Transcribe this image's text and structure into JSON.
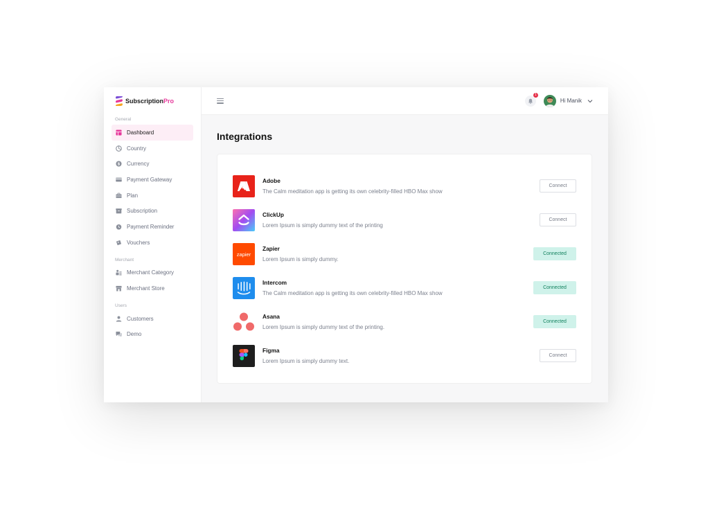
{
  "brand": {
    "name": "Subscription",
    "suffix": "Pro"
  },
  "sidebar": {
    "sections": [
      {
        "label": "General"
      },
      {
        "label": "Merchant"
      },
      {
        "label": "Users"
      }
    ],
    "general_items": [
      {
        "label": "Dashboard",
        "icon": "dashboard-icon",
        "active": true
      },
      {
        "label": "Country",
        "icon": "globe-icon"
      },
      {
        "label": "Currency",
        "icon": "dollar-icon"
      },
      {
        "label": "Payment Gateway",
        "icon": "card-icon"
      },
      {
        "label": "Plan",
        "icon": "briefcase-icon"
      },
      {
        "label": "Subscription",
        "icon": "box-icon"
      },
      {
        "label": "Payment Reminder",
        "icon": "clock-icon"
      },
      {
        "label": "Vouchers",
        "icon": "ticket-icon"
      }
    ],
    "merchant_items": [
      {
        "label": "Merchant Category",
        "icon": "category-icon"
      },
      {
        "label": "Merchant Store",
        "icon": "store-icon"
      }
    ],
    "user_items": [
      {
        "label": "Customers",
        "icon": "user-icon"
      },
      {
        "label": "Demo",
        "icon": "chat-icon"
      }
    ]
  },
  "header": {
    "notification_count": "1",
    "user_greeting": "Hi Manik"
  },
  "page": {
    "title": "Integrations"
  },
  "integrations": [
    {
      "name": "Adobe",
      "description": "The Calm meditation app is getting its own celebrity-filled HBO Max show",
      "button": "Connect",
      "connected": false,
      "brand_color": "#e8231a"
    },
    {
      "name": "ClickUp",
      "description": "Lorem Ipsum is simply dummy text of the printing",
      "button": "Connect",
      "connected": false,
      "brand_color": "#7b68ee"
    },
    {
      "name": "Zapier",
      "description": "Lorem Ipsum is simply dummy.",
      "button": "Connected",
      "connected": true,
      "brand_color": "#ff4a00",
      "logo_text": "zapier"
    },
    {
      "name": "Intercom",
      "description": "The Calm meditation app is getting its own celebrity-filled HBO Max show",
      "button": "Connected",
      "connected": true,
      "brand_color": "#1f8ded"
    },
    {
      "name": "Asana",
      "description": "Lorem Ipsum is simply dummy text of the printing.",
      "button": "Connected",
      "connected": true,
      "brand_color": "#f06a6a"
    },
    {
      "name": "Figma",
      "description": "Lorem Ipsum is simply dummy text.",
      "button": "Connect",
      "connected": false,
      "brand_color": "#1e1e1e"
    }
  ],
  "colors": {
    "accent": "#e6399b",
    "active_bg": "#fdeef6",
    "connected_bg": "#cff2ea",
    "connected_text": "#11805d",
    "badge": "#e5334b"
  }
}
